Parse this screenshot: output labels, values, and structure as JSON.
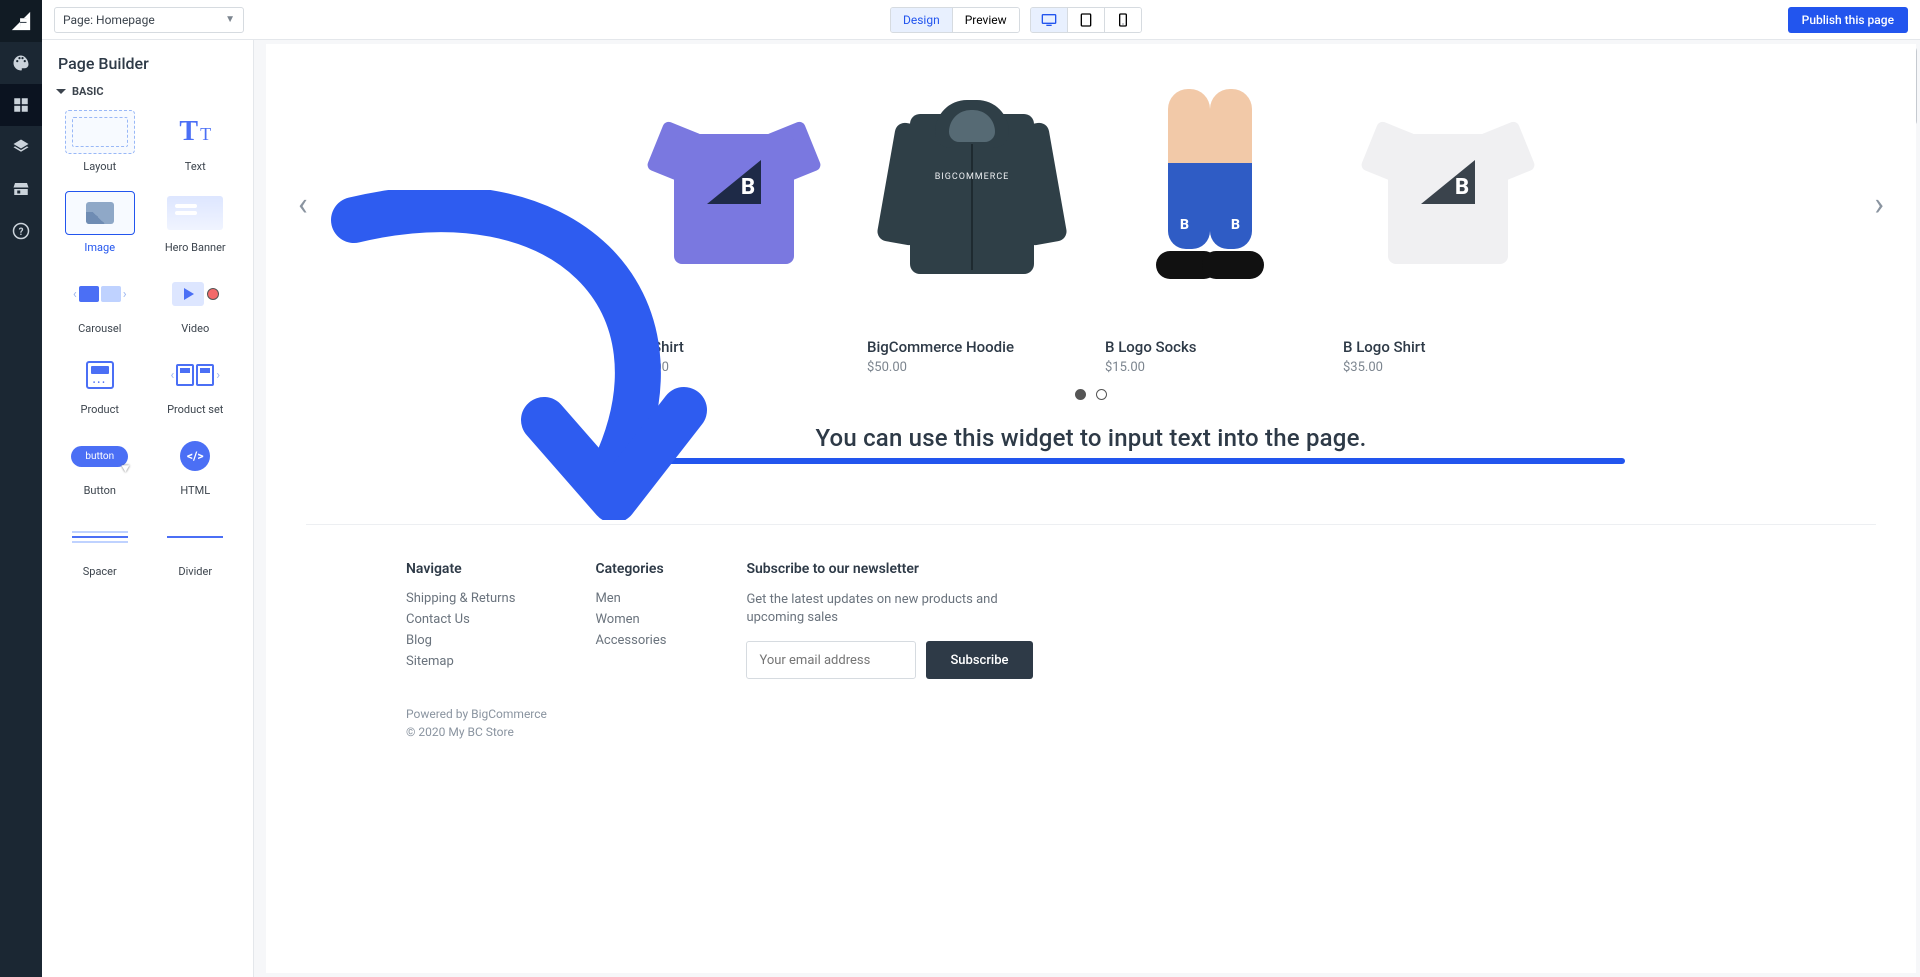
{
  "topbar": {
    "page_selector": "Page: Homepage",
    "design": "Design",
    "preview": "Preview",
    "publish": "Publish this page"
  },
  "panel": {
    "title": "Page Builder",
    "section": "BASIC",
    "widgets": {
      "layout": "Layout",
      "text": "Text",
      "image": "Image",
      "hero": "Hero Banner",
      "carousel": "Carousel",
      "video": "Video",
      "product": "Product",
      "productset": "Product set",
      "button": "Button",
      "button_thumb": "button",
      "html": "HTML",
      "html_thumb": "</>",
      "spacer": "Spacer",
      "divider": "Divider"
    }
  },
  "canvas": {
    "products": [
      {
        "name": "BC Shirt",
        "price": "$20.00"
      },
      {
        "name": "BigCommerce Hoodie",
        "price": "$50.00"
      },
      {
        "name": "B Logo Socks",
        "price": "$15.00"
      },
      {
        "name": "B Logo Shirt",
        "price": "$35.00"
      }
    ],
    "text_widget": "You can use this widget to input text into the page."
  },
  "footer": {
    "navigate": {
      "title": "Navigate",
      "links": [
        "Shipping & Returns",
        "Contact Us",
        "Blog",
        "Sitemap"
      ]
    },
    "categories": {
      "title": "Categories",
      "links": [
        "Men",
        "Women",
        "Accessories"
      ]
    },
    "subscribe": {
      "title": "Subscribe to our newsletter",
      "desc": "Get the latest updates on new products and upcoming sales",
      "placeholder": "Your email address",
      "button": "Subscribe"
    },
    "powered": "Powered by BigCommerce",
    "copyright": "© 2020 My BC Store"
  },
  "hoodie_logo": "BIGCOMMERCE"
}
